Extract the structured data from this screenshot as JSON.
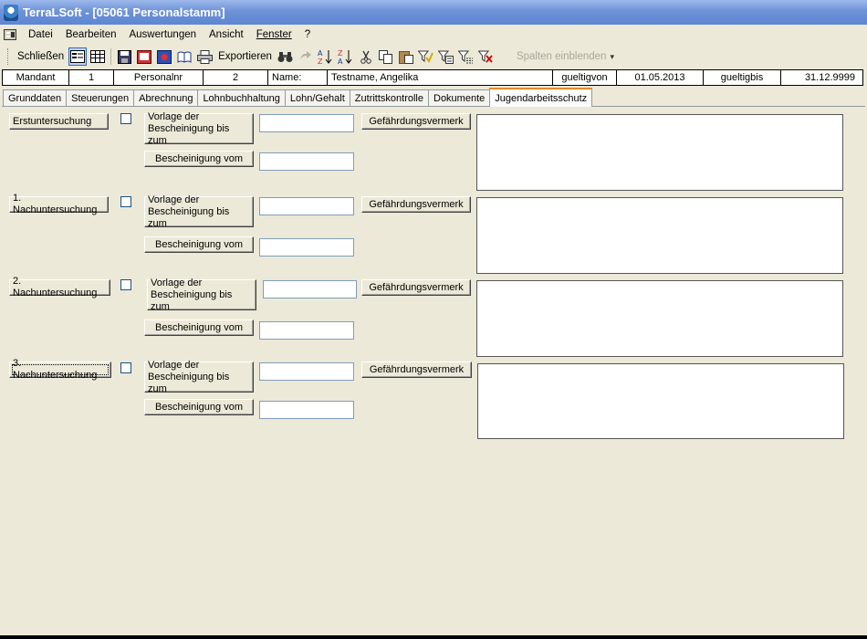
{
  "window": {
    "title": "TerraLSoft - [05061 Personalstamm]"
  },
  "menu": {
    "items": [
      {
        "label": "Datei"
      },
      {
        "label": "Bearbeiten"
      },
      {
        "label": "Auswertungen"
      },
      {
        "label": "Ansicht"
      },
      {
        "label": "Fenster"
      },
      {
        "label": "?"
      }
    ]
  },
  "toolbar": {
    "close_label": "Schließen",
    "export_label": "Exportieren",
    "columns_label": "Spalten einblenden",
    "dropdown_glyph": "▾",
    "icons": [
      "form-view-icon",
      "table-view-icon",
      "save-icon",
      "print-preview-icon",
      "record-icon",
      "book-icon",
      "printer-icon",
      "binoculars-icon",
      "nav-icon",
      "sort-asc-icon",
      "sort-desc-icon",
      "cut-icon",
      "copy-icon",
      "paste-icon",
      "filter-icon",
      "filter-form-icon",
      "filter-list-icon",
      "remove-filter-icon"
    ]
  },
  "info": {
    "mandant_label": "Mandant",
    "mandant_value": "1",
    "personalnr_label": "Personalnr",
    "personalnr_value": "2",
    "name_label": "Name:",
    "name_value": "Testname, Angelika",
    "gueltigvon_label": "gueltigvon",
    "gueltigvon_value": "01.05.2013",
    "gueltigbis_label": "gueltigbis",
    "gueltigbis_value": "31.12.9999"
  },
  "tabs": [
    {
      "label": "Grunddaten"
    },
    {
      "label": "Steuerungen"
    },
    {
      "label": "Abrechnung"
    },
    {
      "label": "Lohnbuchhaltung"
    },
    {
      "label": "Lohn/Gehalt"
    },
    {
      "label": "Zutrittskontrolle"
    },
    {
      "label": "Dokumente"
    },
    {
      "label": "Jugendarbeitsschutz",
      "active": true
    }
  ],
  "sections": [
    {
      "exam_label": "Erstuntersuchung",
      "checked": false,
      "vorlage_label": "Vorlage der Bescheinigung bis zum",
      "vorlage_value": "",
      "bescheinigung_label": "Bescheinigung vom",
      "bescheinigung_value": "",
      "gefaehrdung_label": "Gefährdungsvermerk",
      "memo_value": ""
    },
    {
      "exam_label": "1. Nachuntersuchung",
      "checked": false,
      "vorlage_label": "Vorlage der Bescheinigung bis zum",
      "vorlage_value": "",
      "bescheinigung_label": "Bescheinigung vom",
      "bescheinigung_value": "",
      "gefaehrdung_label": "Gefährdungsvermerk",
      "memo_value": ""
    },
    {
      "exam_label": "2. Nachuntersuchung",
      "checked": false,
      "vorlage_label": "Vorlage der Bescheinigung bis zum",
      "vorlage_value": "",
      "bescheinigung_label": "Bescheinigung vom",
      "bescheinigung_value": "",
      "gefaehrdung_label": "Gefährdungsvermerk",
      "memo_value": ""
    },
    {
      "exam_label": "3. Nachuntersuchung",
      "checked": false,
      "vorlage_label": "Vorlage der Bescheinigung bis zum",
      "vorlage_value": "",
      "bescheinigung_label": "Bescheinigung vom",
      "bescheinigung_value": "",
      "gefaehrdung_label": "Gefährdungsvermerk",
      "memo_value": ""
    }
  ],
  "colors": {
    "window_bg": "#ece9d8",
    "title_gradient_start": "#9db9eb",
    "title_gradient_end": "#5f86d2",
    "active_tab_accent": "#e68b2c"
  }
}
